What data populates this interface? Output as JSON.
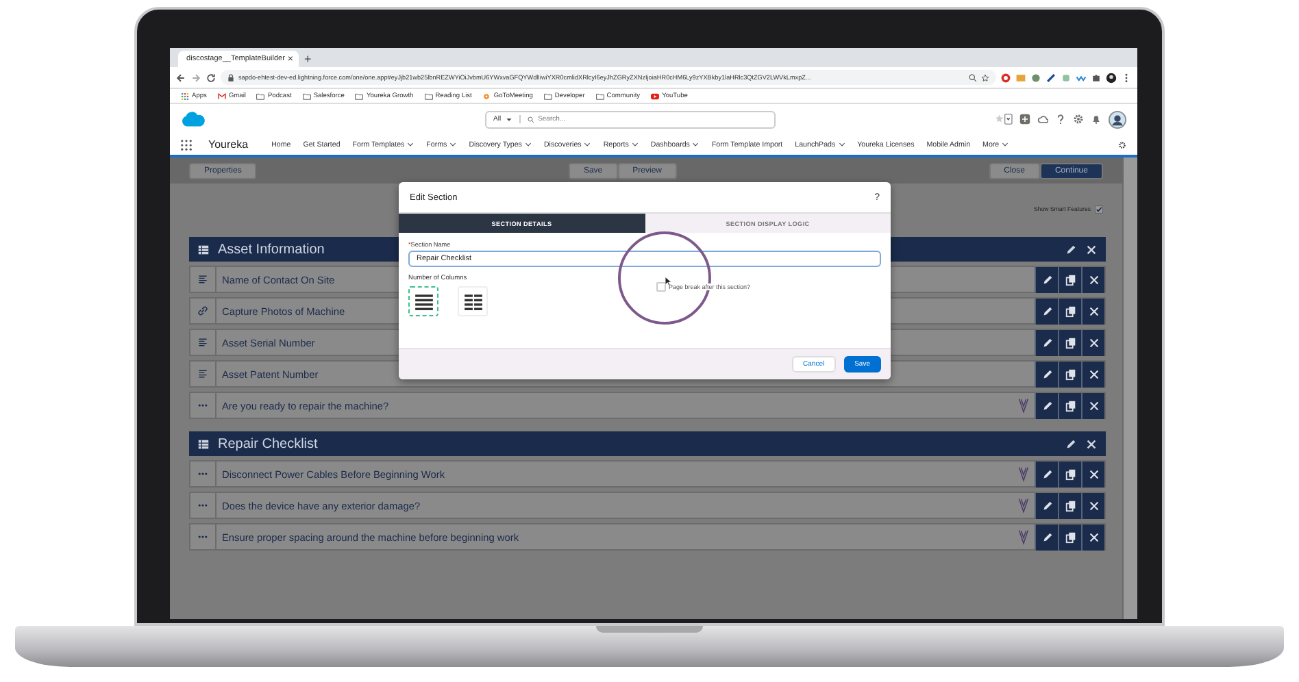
{
  "browser": {
    "tab": {
      "title": "discostage__TemplateBuilder",
      "close": "×"
    },
    "new_tab": "+",
    "url": "sapdo-ehtest-dev-ed.lightning.force.com/one/one.app#eyJjb21wb25lbnREZWYiOiJvbmU6YWxvaGFQYWdlIiwiYXR0cmlidXRlcyI6eyJhZGRyZXNzIjoiaHR0cHM6Ly9zYXBkby1laHRlc3QtZGV2LWVkLmxpZ...",
    "bookmarks": [
      {
        "label": "Apps",
        "kind": "apps"
      },
      {
        "label": "Gmail",
        "kind": "gmail"
      },
      {
        "label": "Podcast",
        "kind": "folder"
      },
      {
        "label": "Salesforce",
        "kind": "folder"
      },
      {
        "label": "Youreka Growth",
        "kind": "folder"
      },
      {
        "label": "Reading List",
        "kind": "folder"
      },
      {
        "label": "GoToMeeting",
        "kind": "flower"
      },
      {
        "label": "Developer",
        "kind": "folder"
      },
      {
        "label": "Community",
        "kind": "folder"
      },
      {
        "label": "YouTube",
        "kind": "video"
      }
    ]
  },
  "header": {
    "search": {
      "scope": "All",
      "placeholder": "Search..."
    }
  },
  "nav": {
    "app_name": "Youreka",
    "items": [
      {
        "label": "Home",
        "dropdown": false
      },
      {
        "label": "Get Started",
        "dropdown": false
      },
      {
        "label": "Form Templates",
        "dropdown": true
      },
      {
        "label": "Forms",
        "dropdown": true
      },
      {
        "label": "Discovery Types",
        "dropdown": true
      },
      {
        "label": "Discoveries",
        "dropdown": true
      },
      {
        "label": "Reports",
        "dropdown": true
      },
      {
        "label": "Dashboards",
        "dropdown": true
      },
      {
        "label": "Form Template Import",
        "dropdown": false
      },
      {
        "label": "LaunchPads",
        "dropdown": true
      },
      {
        "label": "Youreka Licenses",
        "dropdown": false
      },
      {
        "label": "Mobile Admin",
        "dropdown": false
      },
      {
        "label": "More",
        "dropdown": true
      }
    ]
  },
  "toolbar": {
    "left": [
      {
        "label": "Properties",
        "primary": false
      }
    ],
    "center": [
      {
        "label": "Save",
        "primary": false
      },
      {
        "label": "Preview",
        "primary": false
      }
    ],
    "right": [
      {
        "label": "Close",
        "primary": false
      },
      {
        "label": "Continue",
        "primary": true
      }
    ]
  },
  "smart_features": {
    "label": "Show Smart Features",
    "checked": true
  },
  "sections": [
    {
      "title": "Asset Information",
      "rows": [
        {
          "kind": "text",
          "label": "Name of Contact On Site",
          "logic": false
        },
        {
          "kind": "link",
          "label": "Capture Photos of Machine",
          "logic": false
        },
        {
          "kind": "text",
          "label": "Asset Serial Number",
          "logic": false
        },
        {
          "kind": "text",
          "label": "Asset Patent Number",
          "logic": false
        },
        {
          "kind": "more",
          "label": "Are you ready to repair the machine?",
          "logic": true
        }
      ]
    },
    {
      "title": "Repair Checklist",
      "rows": [
        {
          "kind": "more",
          "label": "Disconnect Power Cables Before Beginning Work",
          "logic": true
        },
        {
          "kind": "more",
          "label": "Does the device have any exterior damage?",
          "logic": true
        },
        {
          "kind": "more",
          "label": "Ensure proper spacing around the machine before beginning work",
          "logic": true
        }
      ]
    }
  ],
  "modal": {
    "title": "Edit Section",
    "help": "?",
    "tabs": [
      {
        "label": "SECTION DETAILS",
        "selected": true
      },
      {
        "label": "SECTION DISPLAY LOGIC",
        "selected": false
      }
    ],
    "section_name": {
      "required_mark": "*",
      "label": "Section Name",
      "value": "Repair Checklist"
    },
    "columns": {
      "label": "Number of Columns",
      "options": [
        {
          "kind": "one",
          "selected": true
        },
        {
          "kind": "two",
          "selected": false
        }
      ]
    },
    "page_break": {
      "label": "Page break after this section?",
      "checked": false
    },
    "buttons": [
      {
        "label": "Cancel",
        "primary": false
      },
      {
        "label": "Save",
        "primary": true
      }
    ]
  }
}
